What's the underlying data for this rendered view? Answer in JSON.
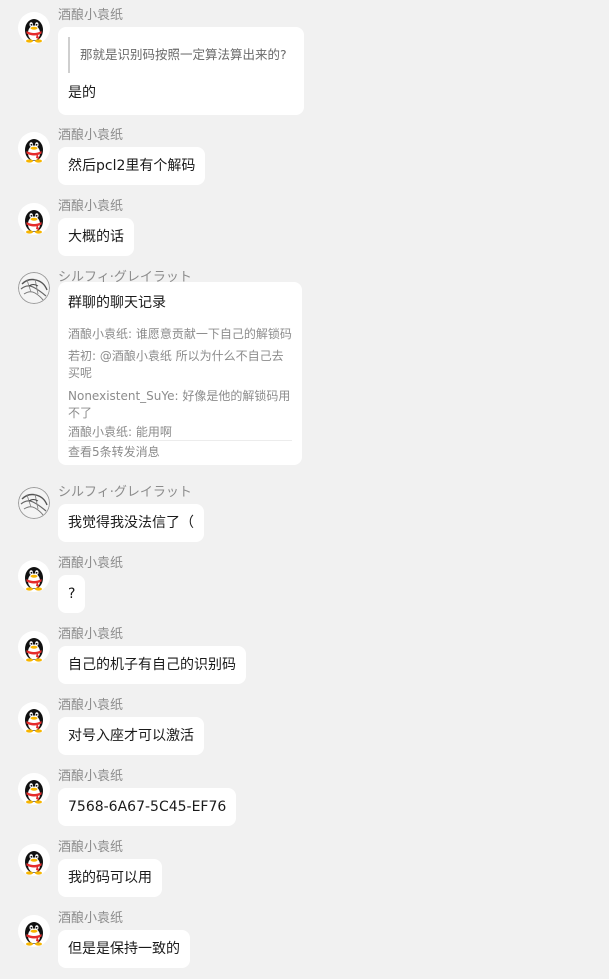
{
  "senders": {
    "jiuniang": "酒酿小袁纸",
    "sylphy": "シルフィ·グレイラット"
  },
  "avatars": {
    "jiuniang": "qq-penguin-avatar",
    "sylphy": "anime-sketch-avatar"
  },
  "messages": [
    {
      "sender": "酒酿小袁纸",
      "quote": "那就是识别码按照一定算法算出来的?",
      "text": "是的"
    },
    {
      "sender": "酒酿小袁纸",
      "text": "然后pcl2里有个解码"
    },
    {
      "sender": "酒酿小袁纸",
      "text": "大概的话"
    },
    {
      "sender": "シルフィ·グレイラット",
      "forward": {
        "title": "群聊的聊天记录",
        "lines": [
          "酒酿小袁纸: 谁愿意贡献一下自己的解锁码",
          "若初: @酒酿小袁纸 所以为什么不自己去买呢",
          "Nonexistent_SuYe: 好像是他的解锁码用不了",
          "酒酿小袁纸: 能用啊"
        ],
        "footer": "查看5条转发消息"
      }
    },
    {
      "sender": "シルフィ·グレイラット",
      "text": "我觉得我没法信了（"
    },
    {
      "sender": "酒酿小袁纸",
      "text": "?"
    },
    {
      "sender": "酒酿小袁纸",
      "text": "自己的机子有自己的识别码"
    },
    {
      "sender": "酒酿小袁纸",
      "text": "对号入座才可以激活"
    },
    {
      "sender": "酒酿小袁纸",
      "text": "7568-6A67-5C45-EF76"
    },
    {
      "sender": "酒酿小袁纸",
      "text": "我的码可以用"
    },
    {
      "sender": "酒酿小袁纸",
      "text": "但是是保持一致的"
    }
  ],
  "colors": {
    "background": "#f1f1f1",
    "bubble": "#ffffff",
    "sender_name": "#8c8c8c",
    "message_text": "#1a1a1a"
  }
}
